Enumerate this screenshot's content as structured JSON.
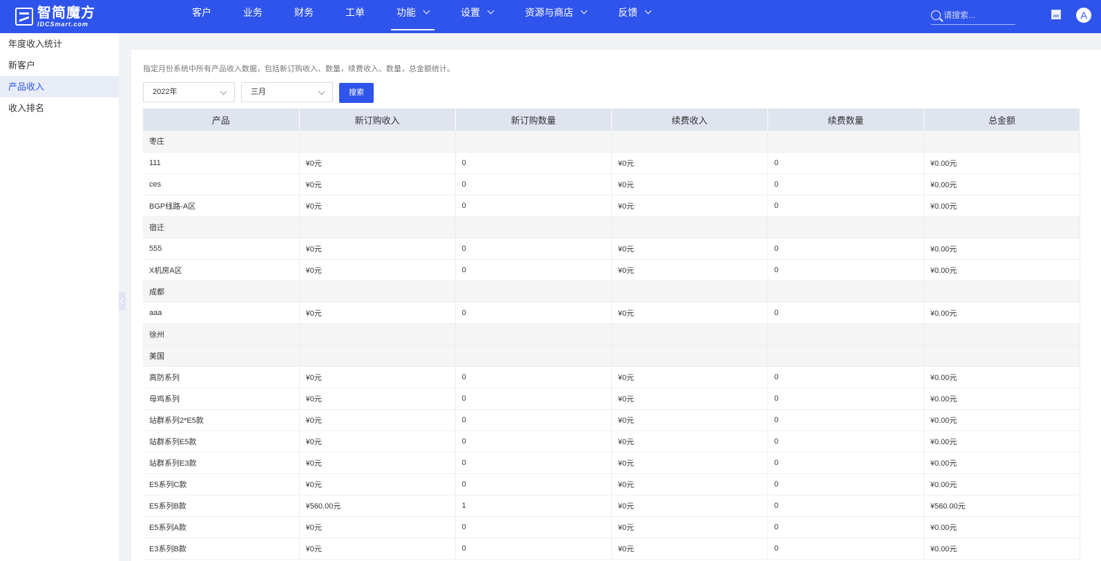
{
  "header": {
    "logo_title": "智简魔方",
    "logo_sub": "IDCSmart.com",
    "nav": [
      {
        "label": "客户",
        "dropdown": false,
        "active": false
      },
      {
        "label": "业务",
        "dropdown": false,
        "active": false
      },
      {
        "label": "财务",
        "dropdown": false,
        "active": false
      },
      {
        "label": "工单",
        "dropdown": false,
        "active": false
      },
      {
        "label": "功能",
        "dropdown": true,
        "active": true
      },
      {
        "label": "设置",
        "dropdown": true,
        "active": false
      },
      {
        "label": "资源与商店",
        "dropdown": true,
        "active": false
      },
      {
        "label": "反馈",
        "dropdown": true,
        "active": false
      }
    ],
    "search_placeholder": "请搜索...",
    "avatar_letter": "A",
    "accent_color": "#2f54eb"
  },
  "sidebar": {
    "items": [
      {
        "label": "年度收入统计",
        "active": false
      },
      {
        "label": "新客户",
        "active": false
      },
      {
        "label": "产品收入",
        "active": true
      },
      {
        "label": "收入排名",
        "active": false
      }
    ]
  },
  "main": {
    "description": "指定月份系统中所有产品收入数据，包括新订购收入、数量，续费收入、数量，总金额统计。",
    "year_select": "2022年",
    "month_select": "三月",
    "search_button": "搜索",
    "table": {
      "columns": [
        "产品",
        "新订购收入",
        "新订购数量",
        "续费收入",
        "续费数量",
        "总金额"
      ],
      "rows": [
        {
          "group": true,
          "cells": [
            "枣庄"
          ]
        },
        {
          "group": false,
          "cells": [
            "111",
            "¥0元",
            "0",
            "¥0元",
            "0",
            "¥0.00元"
          ]
        },
        {
          "group": false,
          "cells": [
            "ces",
            "¥0元",
            "0",
            "¥0元",
            "0",
            "¥0.00元"
          ]
        },
        {
          "group": false,
          "cells": [
            "BGP线路-A区",
            "¥0元",
            "0",
            "¥0元",
            "0",
            "¥0.00元"
          ]
        },
        {
          "group": true,
          "cells": [
            "宿迁"
          ]
        },
        {
          "group": false,
          "cells": [
            "555",
            "¥0元",
            "0",
            "¥0元",
            "0",
            "¥0.00元"
          ]
        },
        {
          "group": false,
          "cells": [
            "X机房A区",
            "¥0元",
            "0",
            "¥0元",
            "0",
            "¥0.00元"
          ]
        },
        {
          "group": true,
          "cells": [
            "成都"
          ]
        },
        {
          "group": false,
          "cells": [
            "aaa",
            "¥0元",
            "0",
            "¥0元",
            "0",
            "¥0.00元"
          ]
        },
        {
          "group": true,
          "cells": [
            "徐州"
          ]
        },
        {
          "group": true,
          "cells": [
            "美国"
          ]
        },
        {
          "group": false,
          "cells": [
            "高防系列",
            "¥0元",
            "0",
            "¥0元",
            "0",
            "¥0.00元"
          ]
        },
        {
          "group": false,
          "cells": [
            "母鸡系列",
            "¥0元",
            "0",
            "¥0元",
            "0",
            "¥0.00元"
          ]
        },
        {
          "group": false,
          "cells": [
            "站群系列2*E5款",
            "¥0元",
            "0",
            "¥0元",
            "0",
            "¥0.00元"
          ]
        },
        {
          "group": false,
          "cells": [
            "站群系列E5款",
            "¥0元",
            "0",
            "¥0元",
            "0",
            "¥0.00元"
          ]
        },
        {
          "group": false,
          "cells": [
            "站群系列E3款",
            "¥0元",
            "0",
            "¥0元",
            "0",
            "¥0.00元"
          ]
        },
        {
          "group": false,
          "cells": [
            "E5系列C款",
            "¥0元",
            "0",
            "¥0元",
            "0",
            "¥0.00元"
          ]
        },
        {
          "group": false,
          "cells": [
            "E5系列B款",
            "¥560.00元",
            "1",
            "¥0元",
            "0",
            "¥560.00元"
          ]
        },
        {
          "group": false,
          "cells": [
            "E5系列A款",
            "¥0元",
            "0",
            "¥0元",
            "0",
            "¥0.00元"
          ]
        },
        {
          "group": false,
          "cells": [
            "E3系列B款",
            "¥0元",
            "0",
            "¥0元",
            "0",
            "¥0.00元"
          ]
        }
      ]
    }
  }
}
